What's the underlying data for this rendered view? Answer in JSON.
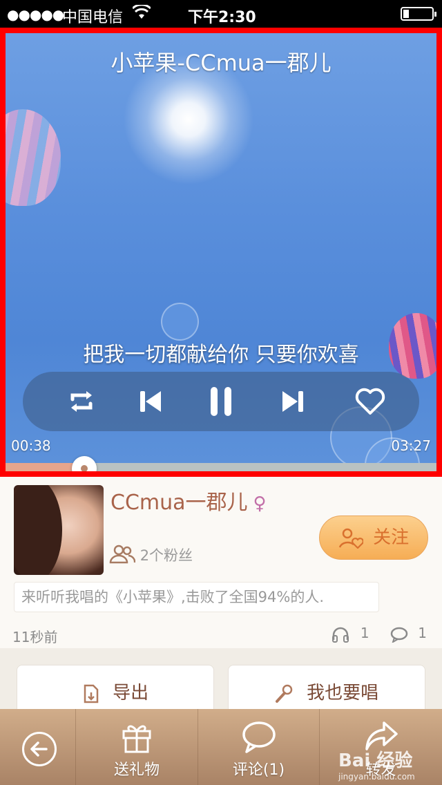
{
  "status_bar": {
    "signal": "●●●●●",
    "carrier": "中国电信",
    "wifi_icon": "wifi-icon",
    "time": "下午2:30",
    "battery_icon": "battery-icon"
  },
  "player": {
    "title": "小苹果-CCmua一郡儿",
    "lyric": "把我一切都献给你 只要你欢喜",
    "elapsed": "00:38",
    "duration": "03:27",
    "progress_fraction": 0.183,
    "controls": {
      "repeat_icon": "repeat-icon",
      "prev_icon": "previous-icon",
      "pause_icon": "pause-icon",
      "next_icon": "next-icon",
      "like_icon": "heart-icon"
    }
  },
  "profile": {
    "username": "CCmua一郡儿",
    "gender": "♀",
    "fans": "2个粉丝",
    "follow_label": "关注",
    "description": "来听听我唱的《小苹果》,击败了全国94%的人.",
    "posted": "11秒前",
    "listens": "1",
    "comments": "1"
  },
  "actions": {
    "export_label": "导出",
    "sing_label": "我也要唱"
  },
  "bottom_bar": {
    "gift_label": "送礼物",
    "comment_label": "评论(1)",
    "share_label": "转发"
  },
  "watermark": {
    "text": "Bai 经验",
    "sub": "jingyan.baidu.com"
  }
}
